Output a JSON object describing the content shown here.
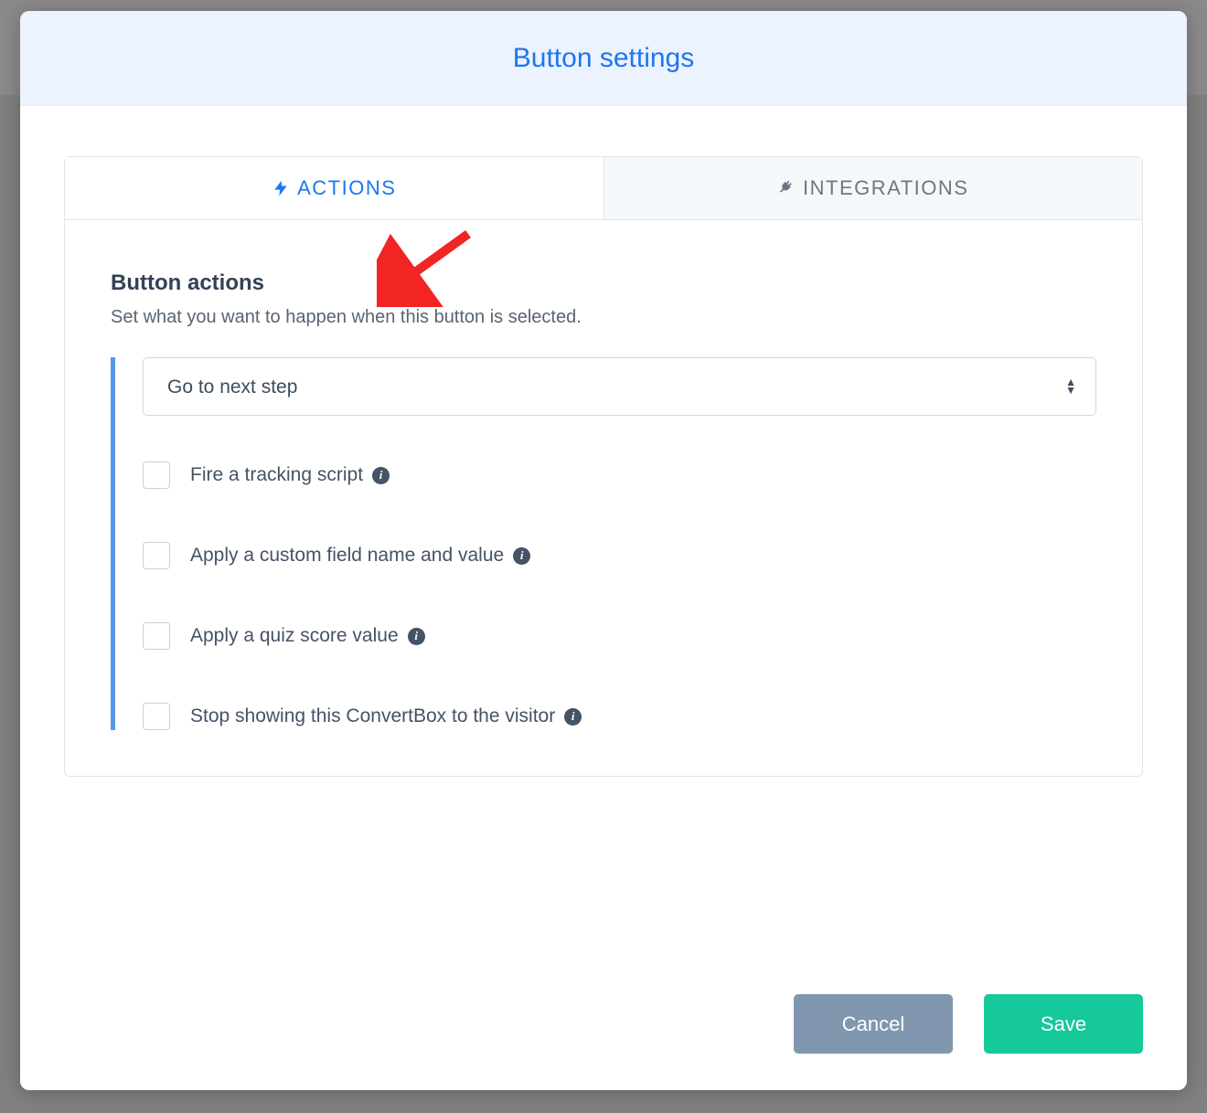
{
  "modal": {
    "title": "Button settings"
  },
  "tabs": {
    "actions": "ACTIONS",
    "integrations": "INTEGRATIONS"
  },
  "section": {
    "title": "Button actions",
    "subtitle": "Set what you want to happen when this button is selected."
  },
  "select": {
    "value": "Go to next step"
  },
  "options": [
    {
      "label": "Fire a tracking script"
    },
    {
      "label": "Apply a custom field name and value"
    },
    {
      "label": "Apply a quiz score value"
    },
    {
      "label": "Stop showing this ConvertBox to the visitor"
    }
  ],
  "footer": {
    "cancel": "Cancel",
    "save": "Save"
  }
}
